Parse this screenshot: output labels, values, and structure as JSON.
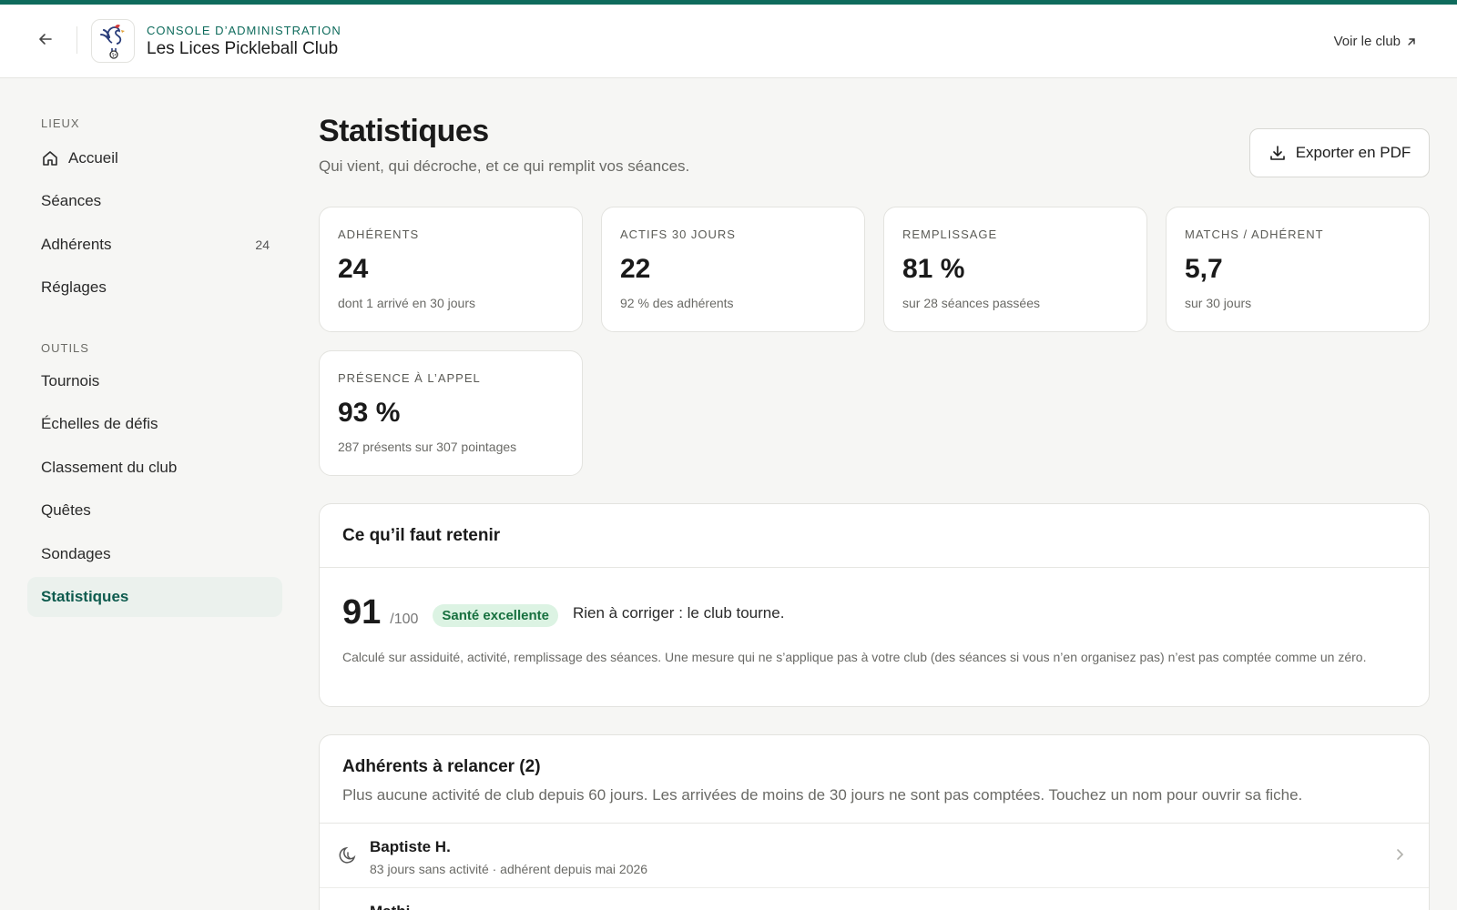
{
  "header": {
    "console_label": "CONSOLE D’ADMINISTRATION",
    "club_name": "Les Lices Pickleball Club",
    "view_club_label": "Voir le club"
  },
  "sidebar": {
    "section_places": "LIEUX",
    "section_tools": "OUTILS",
    "items": [
      {
        "label": "Accueil",
        "icon": "home-icon"
      },
      {
        "label": "Séances"
      },
      {
        "label": "Adhérents",
        "count": "24"
      },
      {
        "label": "Réglages"
      },
      {
        "label": "Tournois"
      },
      {
        "label": "Échelles de défis"
      },
      {
        "label": "Classement du club"
      },
      {
        "label": "Quêtes"
      },
      {
        "label": "Sondages"
      },
      {
        "label": "Statistiques",
        "active": true
      }
    ]
  },
  "main": {
    "title": "Statistiques",
    "subtitle": "Qui vient, qui décroche, et ce qui remplit vos séances.",
    "export_label": "Exporter en PDF",
    "stats": [
      {
        "label": "ADHÉRENTS",
        "value": "24",
        "hint": "dont 1 arrivé en 30 jours"
      },
      {
        "label": "ACTIFS 30 JOURS",
        "value": "22",
        "hint": "92 % des adhérents"
      },
      {
        "label": "REMPLISSAGE",
        "value": "81 %",
        "hint": "sur 28 séances passées"
      },
      {
        "label": "MATCHS / ADHÉRENT",
        "value": "5,7",
        "hint": "sur 30 jours"
      },
      {
        "label": "PRÉSENCE À L’APPEL",
        "value": "93 %",
        "hint": "287 présents sur 307 pointages"
      }
    ],
    "summary": {
      "title": "Ce qu’il faut retenir",
      "score": "91",
      "score_max": "/100",
      "badge": "Santé excellente",
      "message": "Rien à corriger : le club tourne.",
      "note": "Calculé sur assiduité, activité, remplissage des séances. Une mesure qui ne s’applique pas à votre club (des séances si vous n’en organisez pas) n’est pas comptée comme un zéro."
    },
    "relance": {
      "title": "Adhérents à relancer (2)",
      "subtitle": "Plus aucune activité de club depuis 60 jours. Les arrivées de moins de 30 jours ne sont pas comptées. Touchez un nom pour ouvrir sa fiche.",
      "members": [
        {
          "name": "Baptiste H.",
          "meta": "83 jours sans activité · adhérent depuis mai 2026"
        },
        {
          "name": "Mathi…",
          "meta": ""
        }
      ]
    }
  },
  "colors": {
    "accent": "#0e6b5c",
    "active_bg": "#ebf1ed",
    "badge_bg": "#dcf3e3",
    "badge_text": "#17703f"
  }
}
